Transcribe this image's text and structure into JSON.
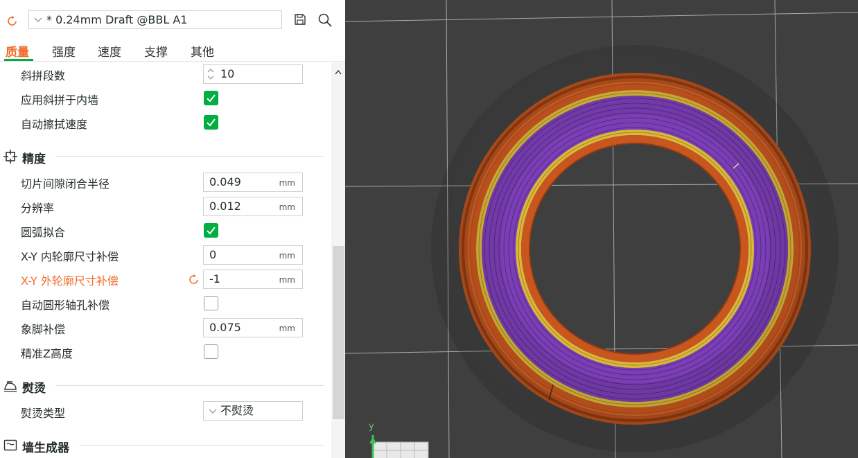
{
  "preset": {
    "value": "* 0.24mm Draft @BBL A1"
  },
  "tabs": [
    {
      "label": "质量",
      "active": true
    },
    {
      "label": "强度"
    },
    {
      "label": "速度"
    },
    {
      "label": "支撑"
    },
    {
      "label": "其他"
    }
  ],
  "options": {
    "scarf_steps": {
      "label": "斜拼段数",
      "value": "10"
    },
    "scarf_inner": {
      "label": "应用斜拼于内墙",
      "checked": true
    },
    "auto_wipe": {
      "label": "自动擦拭速度",
      "checked": true
    }
  },
  "precision": {
    "title": "精度",
    "slice_closing": {
      "label": "切片间隙闭合半径",
      "value": "0.049",
      "unit": "mm"
    },
    "resolution": {
      "label": "分辨率",
      "value": "0.012",
      "unit": "mm"
    },
    "arc_fitting": {
      "label": "圆弧拟合",
      "checked": true
    },
    "xy_hole": {
      "label": "X-Y 内轮廓尺寸补偿",
      "value": "0",
      "unit": "mm"
    },
    "xy_contour": {
      "label": "X-Y 外轮廓尺寸补偿",
      "value": "-1",
      "unit": "mm",
      "modified": true
    },
    "auto_hole": {
      "label": "自动圆形轴孔补偿",
      "checked": false
    },
    "elephant_foot": {
      "label": "象脚补偿",
      "value": "0.075",
      "unit": "mm"
    },
    "precise_z": {
      "label": "精准Z高度",
      "checked": false
    }
  },
  "ironing": {
    "title": "熨烫",
    "type": {
      "label": "熨烫类型",
      "value": "不熨烫"
    }
  },
  "wall_generator": {
    "title": "墙生成器"
  },
  "viewport": {
    "axis_label": "y",
    "bg_color": "#3f3f3f",
    "colors": {
      "outer": "#c9561e",
      "yellow": "#d9b83a",
      "purple": "#7b3fb5"
    }
  }
}
